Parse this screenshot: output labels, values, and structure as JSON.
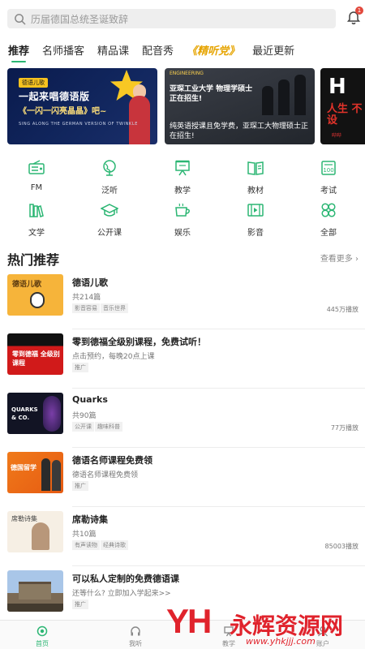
{
  "search": {
    "placeholder": "历届德国总统圣诞致辞"
  },
  "notifications": {
    "count": "1"
  },
  "tabs": [
    {
      "label": "推荐",
      "active": true
    },
    {
      "label": "名师播客"
    },
    {
      "label": "精品课"
    },
    {
      "label": "配音秀"
    },
    {
      "label": "《精听党》",
      "special": true
    },
    {
      "label": "最近更新"
    }
  ],
  "banners": [
    {
      "tag": "德语儿歌",
      "line1": "一起来唱德语版",
      "line2": "《一闪一闪亮晶晶》吧~",
      "line3": "SING ALONG THE GERMAN VERSION OF TWINKLE"
    },
    {
      "tag": "ENGINEERING",
      "line1": "亚琛工业大学 物理学硕士正在招生!",
      "line2": "纯英语授课且免学费，亚琛工大物理硕士正在招生!"
    },
    {
      "big": "H",
      "red": "人生 不设",
      "small": "哔哔"
    }
  ],
  "categories": [
    {
      "label": "FM",
      "icon": "radio-icon"
    },
    {
      "label": "泛听",
      "icon": "globe-icon"
    },
    {
      "label": "教学",
      "icon": "teaching-board-icon"
    },
    {
      "label": "教材",
      "icon": "book-icon"
    },
    {
      "label": "考试",
      "icon": "exam-icon"
    },
    {
      "label": "文学",
      "icon": "bookshelf-icon"
    },
    {
      "label": "公开课",
      "icon": "graduation-cap-icon"
    },
    {
      "label": "娱乐",
      "icon": "coffee-cup-icon"
    },
    {
      "label": "影音",
      "icon": "film-icon"
    },
    {
      "label": "全部",
      "icon": "all-grid-icon"
    }
  ],
  "section": {
    "title": "热门推荐",
    "more": "查看更多"
  },
  "items": [
    {
      "title": "德语儿歌",
      "sub": "共214篇",
      "tags": [
        "影音容易",
        "音乐世界"
      ],
      "plays": "445万播放",
      "thumb_text": "德语儿歌"
    },
    {
      "title": "零到德福全级别课程，免费试听！",
      "sub": "点击预约，每晚20点上课",
      "tags": [
        "推广"
      ],
      "plays": "",
      "thumb_text": "零到德福 全级别课程"
    },
    {
      "title": "Quarks",
      "sub": "共90篇",
      "tags": [
        "公开课",
        "趣味科普"
      ],
      "plays": "77万播放",
      "thumb_text": "QUARKS & CO."
    },
    {
      "title": "德语名师课程免费领",
      "sub": "德语名师课程免费领",
      "tags": [
        "推广"
      ],
      "plays": "",
      "thumb_text": "德国留学"
    },
    {
      "title": "席勒诗集",
      "sub": "共10篇",
      "tags": [
        "有声读物",
        "经典诗歌"
      ],
      "plays": "85003播放",
      "thumb_text": "席勒诗集"
    },
    {
      "title": "可以私人定制的免费德语课",
      "sub": "还等什么? 立即加入学起来>>",
      "tags": [
        "推广"
      ],
      "plays": "",
      "thumb_text": ""
    }
  ],
  "bottom_nav": [
    {
      "label": "首页",
      "active": true
    },
    {
      "label": "我听"
    },
    {
      "label": "教学"
    },
    {
      "label": "账户"
    }
  ],
  "watermark": {
    "logo": "YH",
    "cn": "永辉资源网",
    "url": "www.yhkjjj.com"
  },
  "colors": {
    "accent": "#2bb673",
    "special_tab": "#e6a400",
    "watermark": "#e0232c"
  }
}
